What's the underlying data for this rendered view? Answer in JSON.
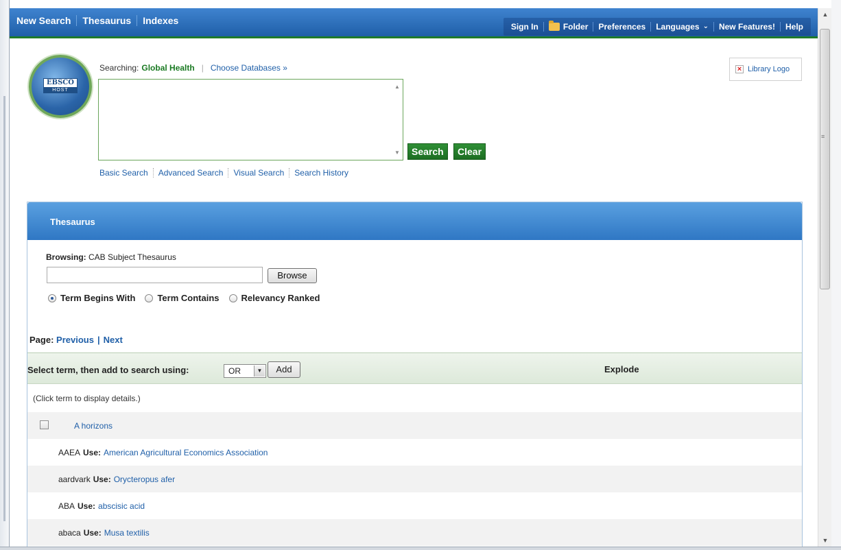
{
  "topnav": {
    "new_search": "New Search",
    "thesaurus": "Thesaurus",
    "indexes": "Indexes"
  },
  "toolbar": {
    "sign_in": "Sign In",
    "folder": "Folder",
    "preferences": "Preferences",
    "languages": "Languages",
    "new_features": "New Features!",
    "help": "Help"
  },
  "logo": {
    "top": "EBSCO",
    "bottom": "HOST"
  },
  "search": {
    "searching_label": "Searching:",
    "database": "Global Health",
    "choose_databases": "Choose Databases »",
    "query": "",
    "search_btn": "Search",
    "clear_btn": "Clear",
    "links": [
      "Basic Search",
      "Advanced Search",
      "Visual Search",
      "Search History"
    ]
  },
  "library_logo": "Library Logo",
  "thesaurus": {
    "title": "Thesaurus",
    "browsing_label": "Browsing:",
    "browsing_value": "CAB Subject Thesaurus",
    "browse_input": "",
    "browse_btn": "Browse",
    "options": [
      {
        "label": "Term Begins With",
        "selected": true
      },
      {
        "label": "Term Contains",
        "selected": false
      },
      {
        "label": "Relevancy Ranked",
        "selected": false
      }
    ],
    "page_label": "Page:",
    "previous": "Previous",
    "next": "Next",
    "add_label": "Select term, then add to search using:",
    "operator": "OR",
    "add_btn": "Add",
    "explode": "Explode",
    "hint": "(Click term to display details.)",
    "use_label": "Use:",
    "terms": [
      {
        "term": "A horizons",
        "checkbox": true
      },
      {
        "term": "AAEA",
        "use": "American Agricultural Economics Association"
      },
      {
        "term": "aardvark",
        "use": "Orycteropus afer"
      },
      {
        "term": "ABA",
        "use": "abscisic acid"
      },
      {
        "term": "abaca",
        "use": "Musa textilis"
      }
    ]
  },
  "colors": {
    "accent_blue": "#1f5fa8",
    "accent_green": "#1d6e22"
  }
}
